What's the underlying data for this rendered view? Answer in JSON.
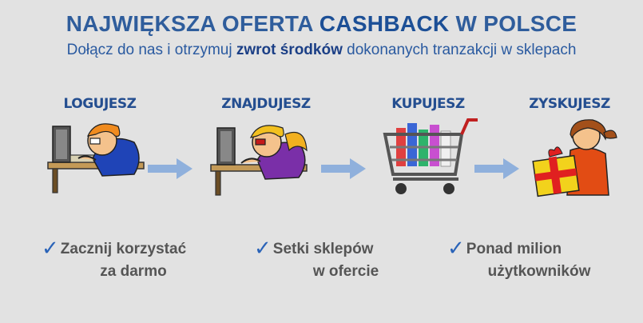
{
  "header": {
    "title_part1": "NAJWIĘKSZA OFERTA ",
    "title_part2": "CASHBACK",
    "title_part3": " W POLSCE",
    "subtitle_part1": "Dołącz do nas i otrzymuj ",
    "subtitle_part2": "zwrot środków",
    "subtitle_part3": " dokonanych tranzakcji w sklepach"
  },
  "steps": [
    {
      "label": "LOGUJESZ",
      "icon": "person-at-computer-icon"
    },
    {
      "label": "ZNAJDUJESZ",
      "icon": "person-searching-computer-icon"
    },
    {
      "label": "KUPUJESZ",
      "icon": "shopping-cart-icon"
    },
    {
      "label": "ZYSKUJESZ",
      "icon": "person-with-gift-icon"
    }
  ],
  "benefits": [
    {
      "line1": "Zacznij korzystać",
      "line2": "za darmo"
    },
    {
      "line1": "Setki sklepów",
      "line2": "w ofercie"
    },
    {
      "line1": "Ponad milion",
      "line2": "użytkowników"
    }
  ],
  "colors": {
    "background": "#e2e2e2",
    "title": "#2f5d9c",
    "arrow": "#8fb0dc",
    "check": "#2a63b8"
  }
}
